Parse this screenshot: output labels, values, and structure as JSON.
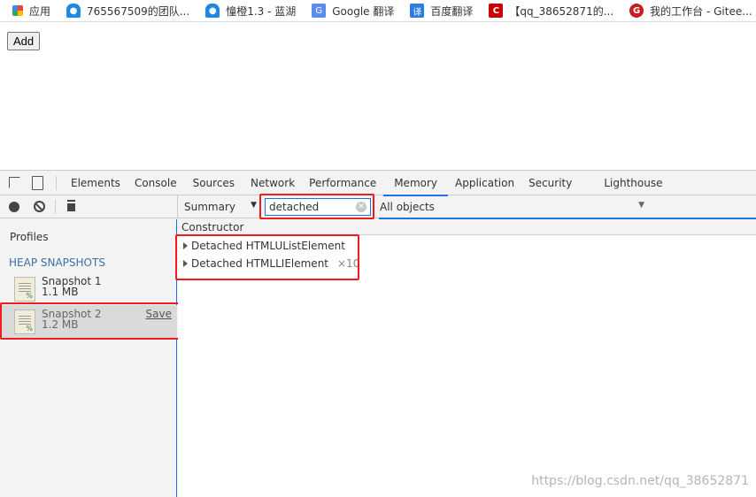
{
  "bookmarks": [
    {
      "label": "应用",
      "icon": "apps-grid-icon",
      "color": "#4285f4"
    },
    {
      "label": "765567509的团队...",
      "icon": "lanhu-icon",
      "color": "#1e88e5"
    },
    {
      "label": "憧橙1.3 - 蓝湖",
      "icon": "lanhu-icon",
      "color": "#1e88e5"
    },
    {
      "label": "Google 翻译",
      "icon": "google-translate-icon",
      "color": "#5b8def"
    },
    {
      "label": "百度翻译",
      "icon": "baidu-translate-icon",
      "color": "#2a7de1"
    },
    {
      "label": "【qq_38652871的...",
      "icon": "csdn-icon",
      "color": "#c9000a"
    },
    {
      "label": "我的工作台 - Gitee...",
      "icon": "gitee-icon",
      "color": "#c71d23"
    }
  ],
  "page": {
    "add_label": "Add"
  },
  "devtools": {
    "tabs": [
      "Elements",
      "Console",
      "Sources",
      "Network",
      "Performance",
      "Memory",
      "Application",
      "Security",
      "Lighthouse"
    ],
    "active_tab": "Memory",
    "view_select": "Summary",
    "filter_value": "detached",
    "objects_select": "All objects",
    "profiles_label": "Profiles",
    "heap_header": "HEAP SNAPSHOTS",
    "snapshots": [
      {
        "name": "Snapshot 1",
        "size": "1.1 MB"
      },
      {
        "name": "Snapshot 2",
        "size": "1.2 MB",
        "save": "Save"
      }
    ],
    "column_header": "Constructor",
    "rows": [
      {
        "name": "Detached HTMLUListElement",
        "count": ""
      },
      {
        "name": "Detached HTMLLIElement",
        "count": "×10"
      }
    ],
    "accent": "#1a73e8",
    "highlight": "#f21a1a"
  },
  "watermark": "https://blog.csdn.net/qq_38652871"
}
